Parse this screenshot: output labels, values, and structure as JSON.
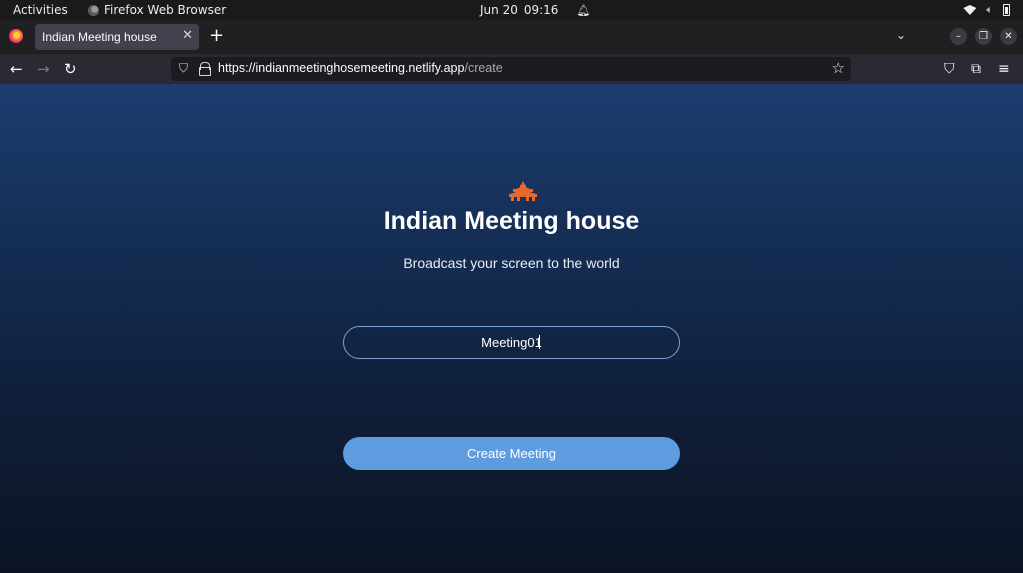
{
  "system_bar": {
    "activities": "Activities",
    "app_name": "Firefox Web Browser",
    "date": "Jun 20",
    "time": "09:16"
  },
  "browser": {
    "tab_title": "Indian Meeting house",
    "url_host": "https://indianmeetinghosemeeting.netlify.app",
    "url_path": "/create"
  },
  "page": {
    "title": "Indian Meeting house",
    "subtitle": "Broadcast your screen to the world",
    "meeting_input_value": "Meeting01",
    "create_button": "Create Meeting",
    "colors": {
      "accent": "#5e9cdf",
      "background_top": "#1d3d70",
      "background_bottom": "#0c1424",
      "logo": "#e8692b"
    }
  },
  "icons": [
    "firefox-icon",
    "close-icon",
    "plus-icon",
    "chevron-down-icon",
    "minimize-icon",
    "restore-icon",
    "window-close-icon",
    "back-arrow-icon",
    "forward-arrow-icon",
    "reload-icon",
    "shield-icon",
    "lock-icon",
    "star-icon",
    "pocket-icon",
    "extensions-icon",
    "hamburger-menu-icon",
    "wifi-icon",
    "volume-icon",
    "battery-icon",
    "bell-icon"
  ]
}
